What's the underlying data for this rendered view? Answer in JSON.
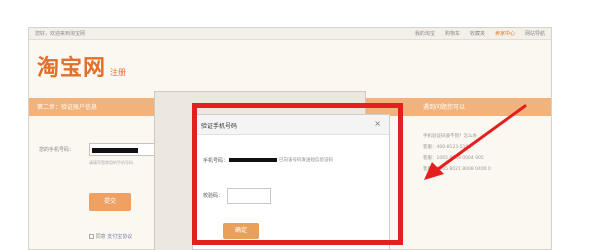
{
  "browser": {
    "top_left_text": "您好，欢迎来到淘宝网",
    "top_links": [
      "我的淘宝",
      "购物车",
      "收藏夹",
      "卖家中心",
      "网站导航"
    ]
  },
  "brand": {
    "logo_text": "淘宝网",
    "logo_sub": "注册"
  },
  "steps": {
    "current": "第二步：验证账户信息",
    "side_title": "遇到问题您可以"
  },
  "form": {
    "phone_label": "您的手机号码：",
    "hint": "请填写您常用的手机号码",
    "submit_label": "提交",
    "agree_text": "同意",
    "agree_link": "支付宝协议"
  },
  "sidebar": {
    "items": [
      "手机验证码收不到？怎么办",
      "客服：400-8123-5196",
      "客服：1065 0009 0004 905",
      "客服：1065 8021 8008 0400 0"
    ]
  },
  "dialog": {
    "title": "验证手机号码",
    "close_symbol": "×",
    "phone_label": "手机号码：",
    "phone_note": "已向该号码发送短信验证码",
    "code_label": "校验码：",
    "code_value": "",
    "confirm_label": "确定"
  },
  "colors": {
    "accent": "#e36f2a",
    "annotation": "#e4201f"
  }
}
